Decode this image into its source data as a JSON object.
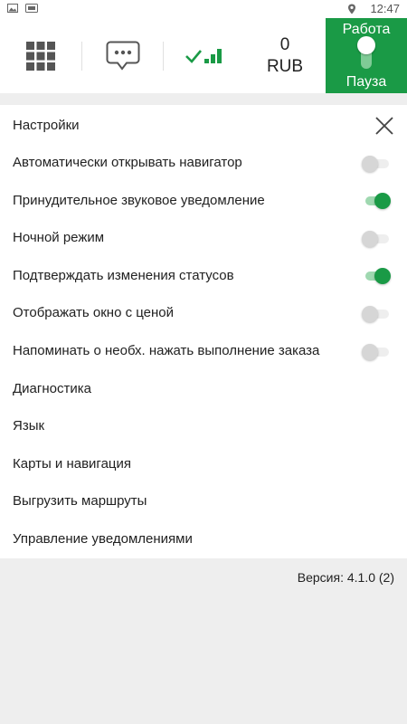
{
  "status_bar": {
    "left_icons": [
      "image-notification-icon",
      "sim-notification-icon"
    ],
    "location_icon": "location-pin-icon",
    "time": "12:47"
  },
  "toolbar": {
    "menu_icon": "grid-menu-icon",
    "chat_icon": "chat-bubble-icon",
    "signal_icon": "connection-signal-icon",
    "balance_amount": "0",
    "balance_currency": "RUB",
    "work_label": "Работа",
    "pause_label": "Пауза",
    "accent_color": "#1a9a46"
  },
  "settings": {
    "title": "Настройки",
    "close_icon": "close-icon",
    "items": [
      {
        "label": "Автоматически открывать навигатор",
        "type": "toggle",
        "on": false
      },
      {
        "label": "Принудительное звуковое уведомление",
        "type": "toggle",
        "on": true
      },
      {
        "label": "Ночной режим",
        "type": "toggle",
        "on": false
      },
      {
        "label": "Подтверждать изменения статусов",
        "type": "toggle",
        "on": true
      },
      {
        "label": "Отображать окно с ценой",
        "type": "toggle",
        "on": false
      },
      {
        "label": "Напоминать о необх. нажать выполнение заказа",
        "type": "toggle",
        "on": false
      },
      {
        "label": "Диагностика",
        "type": "link"
      },
      {
        "label": "Язык",
        "type": "link"
      },
      {
        "label": "Карты и навигация",
        "type": "link"
      },
      {
        "label": "Выгрузить маршруты",
        "type": "link"
      },
      {
        "label": "Управление уведомлениями",
        "type": "link"
      }
    ]
  },
  "version_text": "Версия: 4.1.0 (2)"
}
